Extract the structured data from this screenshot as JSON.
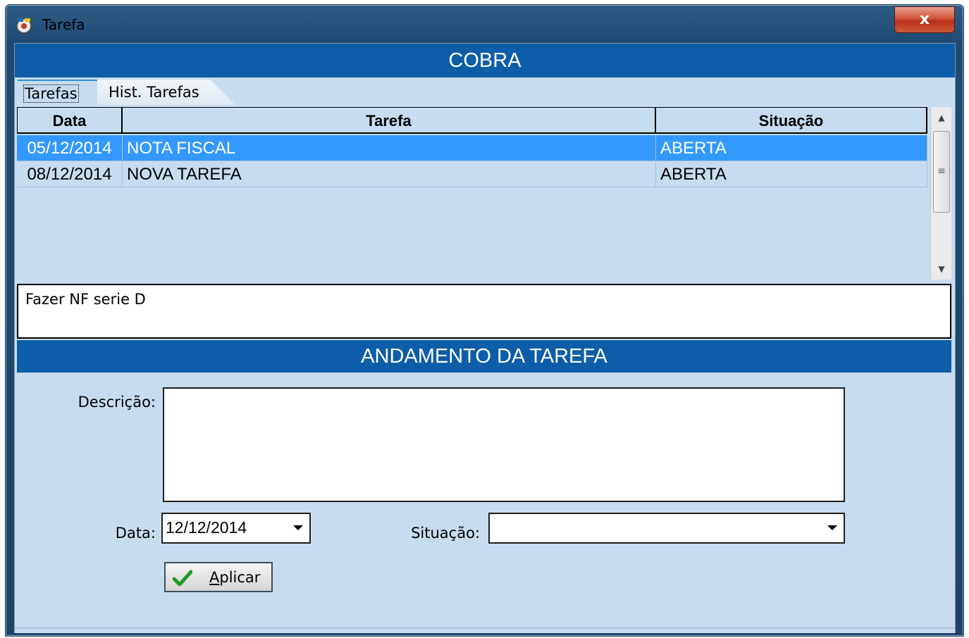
{
  "window": {
    "title": "Tarefa",
    "close_label": "x"
  },
  "header": {
    "banner": "COBRA"
  },
  "tabs": [
    {
      "label": "Tarefas",
      "active": true
    },
    {
      "label": "Hist. Tarefas",
      "active": false
    }
  ],
  "grid": {
    "columns": [
      "Data",
      "Tarefa",
      "Situação"
    ],
    "rows": [
      {
        "data": "05/12/2014",
        "tarefa": "NOTA FISCAL",
        "situacao": "ABERTA",
        "selected": true
      },
      {
        "data": "08/12/2014",
        "tarefa": "NOVA TAREFA",
        "situacao": "ABERTA",
        "selected": false
      }
    ]
  },
  "note": {
    "text": "Fazer NF serie D"
  },
  "andamento": {
    "banner": "ANDAMENTO DA TAREFA",
    "descricao_label": "Descrição:",
    "descricao_value": "",
    "data_label": "Data:",
    "data_value": "12/12/2014",
    "situacao_label": "Situação:",
    "situacao_value": "",
    "apply_button_prefix": "",
    "apply_button_accel": "A",
    "apply_button_rest": "plicar"
  },
  "colors": {
    "banner": "#0e5da8",
    "client_bg": "#c7dcef",
    "selection": "#3399ff"
  }
}
